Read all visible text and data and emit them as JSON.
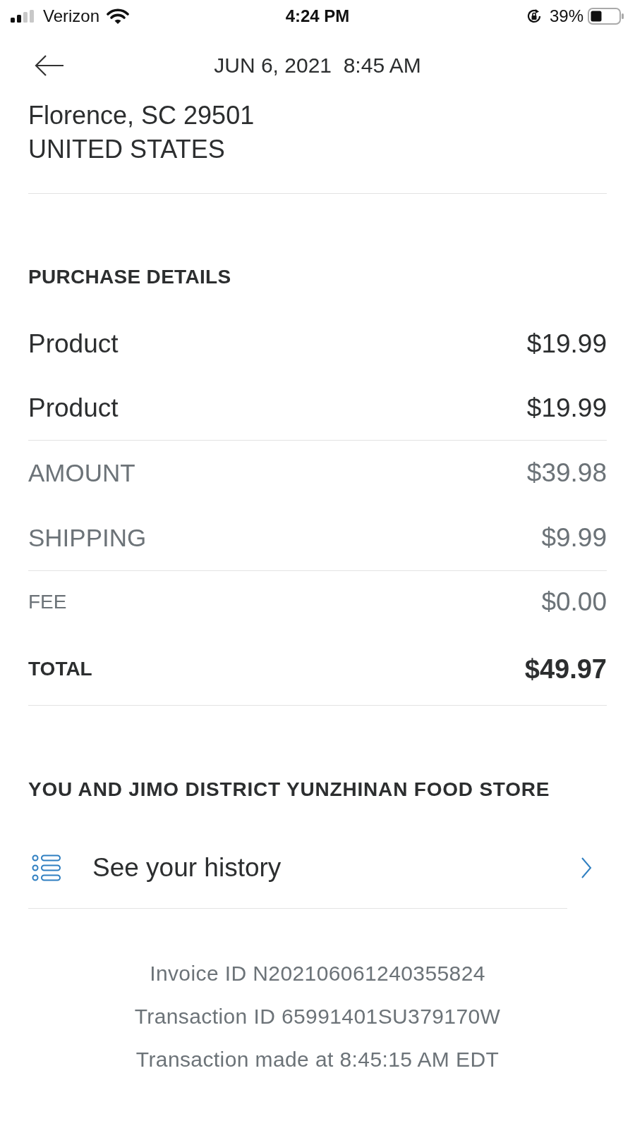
{
  "status_bar": {
    "carrier": "Verizon",
    "time": "4:24 PM",
    "battery": "39%"
  },
  "header": {
    "title": "JUN 6, 2021  8:45 AM"
  },
  "address": [
    "Florence, SC 29501",
    "UNITED STATES"
  ],
  "purchase_details": {
    "heading": "PURCHASE DETAILS",
    "groups": [
      {
        "rows": [
          {
            "kind": "item",
            "label": "Product",
            "amount": "$19.99"
          },
          {
            "kind": "item",
            "label": "Product",
            "amount": "$19.99"
          }
        ]
      },
      {
        "rows": [
          {
            "kind": "subtotal",
            "label": "AMOUNT",
            "amount": "$39.98"
          },
          {
            "kind": "subtotal",
            "label": "SHIPPING",
            "amount": "$9.99"
          }
        ]
      },
      {
        "rows": [
          {
            "kind": "fee",
            "label": "FEE",
            "amount": "$0.00"
          },
          {
            "kind": "total",
            "label": "TOTAL",
            "amount": "$49.97"
          }
        ]
      }
    ]
  },
  "counterparty": {
    "heading": "YOU AND JIMO DISTRICT YUNZHINAN FOOD STORE",
    "link": "See your history"
  },
  "footer": [
    "Invoice ID N202106061240355824",
    "Transaction ID 65991401SU379170W",
    "Transaction made at 8:45:15 AM EDT"
  ]
}
